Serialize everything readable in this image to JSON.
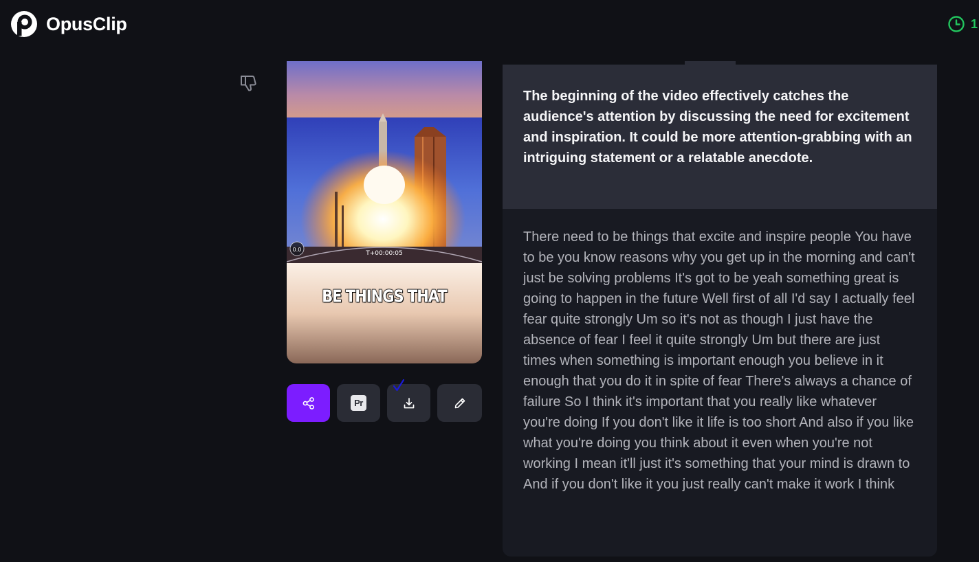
{
  "app": {
    "name": "OpusClip",
    "logo_icon": "opusclip-logo-icon",
    "credits_icon": "clock-icon",
    "credits_text": "1",
    "accent_color": "#7c1dff",
    "credits_color": "#22c55e"
  },
  "clip": {
    "caption": "BE THINGS THAT",
    "overlay_counter": "0.0",
    "overlay_timer": "T+00:00:05",
    "feedback_icon": "thumbs-down-icon"
  },
  "actions": [
    {
      "name": "share",
      "icon": "share-icon"
    },
    {
      "name": "premiere",
      "icon": "premiere-pro-icon",
      "label": "Pr"
    },
    {
      "name": "download",
      "icon": "download-icon"
    },
    {
      "name": "edit",
      "icon": "pencil-icon"
    }
  ],
  "analysis": {
    "summary": "The beginning of the video effectively catches the audience's attention by discussing the need for excitement and inspiration. It could be more attention-grabbing with an intriguing statement or a relatable anecdote.",
    "transcript": "There need to be things that excite and inspire people You have to be you know reasons why you get up in the morning and can't just be solving problems It's got to be yeah something great is going to happen in the future Well first of all I'd say I actually feel fear quite strongly Um so it's not as though I just have the absence of fear I feel it quite strongly Um but there are just times when something is important enough you believe in it enough that you do it in spite of fear There's always a chance of failure So I think it's important that you really like whatever you're doing If you don't like it life is too short And also if you like what you're doing you think about it even when you're not working I mean it'll just it's something that your mind is drawn to And if you don't like it you just really can't make it work I think"
  }
}
